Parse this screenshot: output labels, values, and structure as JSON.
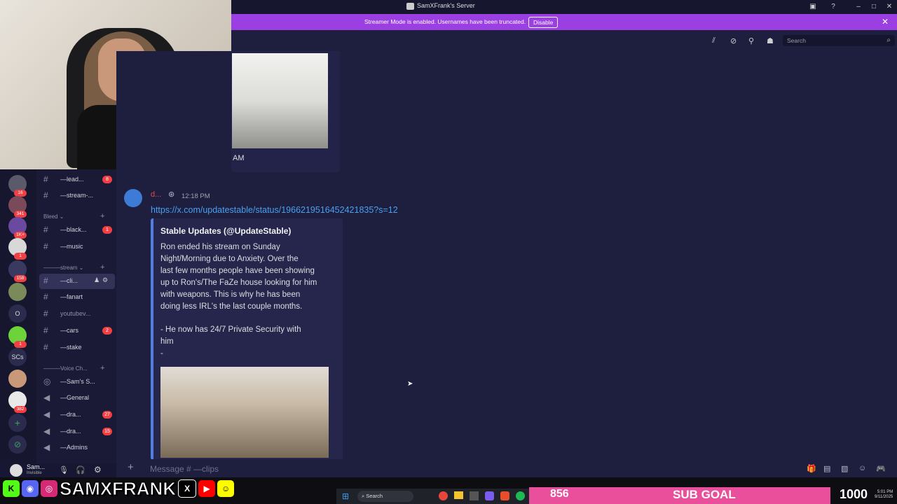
{
  "window": {
    "title": "SamXFrank's Server"
  },
  "banner": {
    "text": "Streamer Mode is enabled. Usernames have been truncated.",
    "button": "Disable"
  },
  "header": {
    "search_placeholder": "Search"
  },
  "servers": [
    {
      "badge": "16"
    },
    {
      "badge": "341"
    },
    {
      "badge": "1K+"
    },
    {
      "badge": "1"
    },
    {
      "badge": "158"
    },
    {
      "badge": ""
    },
    {
      "label": "O"
    },
    {
      "badge": "1"
    },
    {
      "label": "SCs"
    },
    {
      "badge": ""
    },
    {
      "badge": "382"
    }
  ],
  "channels": {
    "lead": {
      "name": "—lead...",
      "badge": "8"
    },
    "stream_top": {
      "name": "—stream-..."
    },
    "cat_bleed": "Bleed",
    "black": {
      "name": "—black...",
      "badge": "1"
    },
    "music": {
      "name": "—music"
    },
    "cat_stream": "———stream",
    "clips": {
      "name": "—cli..."
    },
    "fanart": {
      "name": "—fanart"
    },
    "youtube": {
      "name": "youtubev..."
    },
    "cars": {
      "name": "—cars",
      "badge": "2"
    },
    "stake": {
      "name": "—stake"
    },
    "cat_voice": "———Voice Ch...",
    "sams": {
      "name": "—Sam's S..."
    },
    "general": {
      "name": "—General"
    },
    "dra1": {
      "name": "—dra...",
      "badge": "27"
    },
    "dra2": {
      "name": "—dra...",
      "badge": "15"
    },
    "admins": {
      "name": "—Admins"
    }
  },
  "user": {
    "name": "Sam...",
    "status": "Invisible"
  },
  "previous_message": {
    "text": "AM"
  },
  "message": {
    "author": "d...",
    "time": "12:18 PM",
    "link": "https://x.com/updatestable/status/1966219516452421835?s=12",
    "embed": {
      "title": "Stable Updates (@UpdateStable)",
      "lines": [
        "Ron ended his stream on Sunday",
        "Night/Morning due to Anxiety. Over the",
        "last few months people have been showing",
        "up to Ron's/The FaZe house looking for him",
        "with weapons. This is why he has been",
        "doing less IRL's the last couple months.",
        "",
        "- He now has 24/7 Private Security with",
        "him",
        "-"
      ]
    }
  },
  "composer": {
    "placeholder": "Message # —clips"
  },
  "overlay": {
    "brand": "SAMXFRANK",
    "taskbar_search": "Search",
    "sub_count": "856",
    "goal_label": "SUB GOAL",
    "goal_target": "1000",
    "clock_time": "5:01 PM",
    "clock_date": "9/11/2025"
  },
  "colors": {
    "accent": "#9b3fe3",
    "link": "#4aa0f0",
    "embed_bar": "#4f7fe0",
    "badge": "#f23f43",
    "goal": "#e94f9b"
  }
}
